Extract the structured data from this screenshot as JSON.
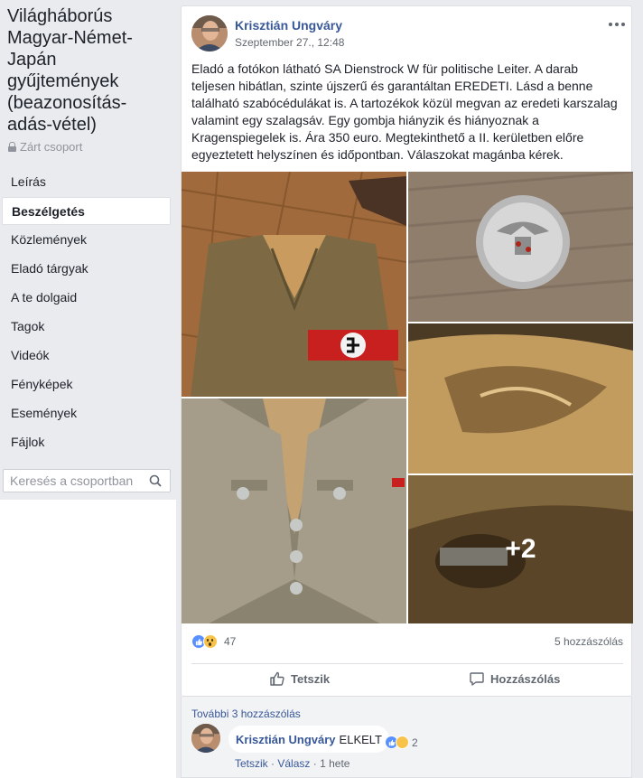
{
  "group": {
    "title": "Világháborús Magyar-Német-Japán gyűjtemények (beazonosítás-adás-vétel)",
    "privacy": "Zárt csoport"
  },
  "nav": {
    "items": [
      {
        "label": "Leírás",
        "active": false
      },
      {
        "label": "Beszélgetés",
        "active": true
      },
      {
        "label": "Közlemények",
        "active": false
      },
      {
        "label": "Eladó tárgyak",
        "active": false
      },
      {
        "label": "A te dolgaid",
        "active": false
      },
      {
        "label": "Tagok",
        "active": false
      },
      {
        "label": "Videók",
        "active": false
      },
      {
        "label": "Fényképek",
        "active": false
      },
      {
        "label": "Események",
        "active": false
      },
      {
        "label": "Fájlok",
        "active": false
      }
    ]
  },
  "search": {
    "placeholder": "Keresés a csoportban",
    "icon": "search-icon"
  },
  "post": {
    "author": "Krisztián Ungváry",
    "timestamp": "Szeptember 27., 12:48",
    "text": "Eladó a fotókon látható SA Dienstrock W für politische Leiter. A darab teljesen hibátlan, szinte újszerű és garantáltan EREDETI. Lásd a benne található szabócédulákat is. A tartozékok közül megvan az eredeti karszalag valamint egy szalagsáv. Egy gombja hiányzik és hiányoznak a Kragenspiegelek is. Ára 350 euro. Megtekinthető a II. kerületben előre egyeztetett helyszínen és időpontban. Válaszokat magánba kérek.",
    "more_photos": "+2",
    "reaction_count": "47",
    "comment_count": "5 hozzászólás",
    "like_label": "Tetszik",
    "comment_label": "Hozzászólás"
  },
  "comments": {
    "more_label": "További 3 hozzászólás",
    "items": [
      {
        "author": "Krisztián Ungváry",
        "text": "ELKELT",
        "reaction_count": "2",
        "like": "Tetszik",
        "reply": "Válasz",
        "time": "1 hete"
      }
    ]
  },
  "colors": {
    "link": "#385898",
    "background": "#e9ebee",
    "like_blue": "#5890ff"
  }
}
